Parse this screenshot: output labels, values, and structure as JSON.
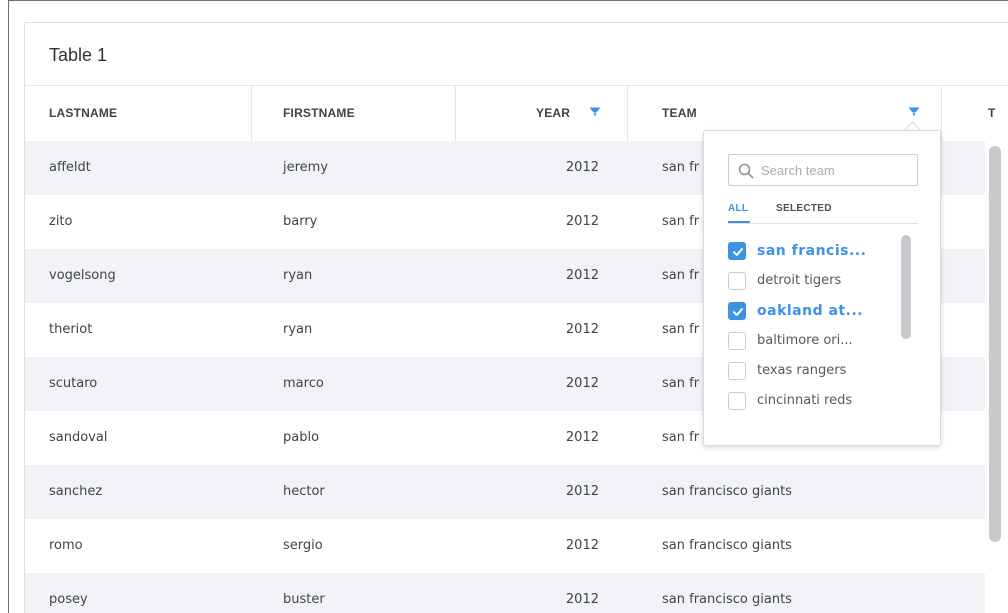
{
  "table": {
    "title": "Table 1",
    "columns": [
      {
        "key": "lastname",
        "label": "LASTNAME"
      },
      {
        "key": "firstname",
        "label": "FIRSTNAME"
      },
      {
        "key": "year",
        "label": "YEAR"
      },
      {
        "key": "team",
        "label": "TEAM"
      },
      {
        "key": "next",
        "label": "T"
      }
    ],
    "rows": [
      {
        "lastname": "affeldt",
        "firstname": "jeremy",
        "year": "2012",
        "team": "san fr"
      },
      {
        "lastname": "zito",
        "firstname": "barry",
        "year": "2012",
        "team": "san fr"
      },
      {
        "lastname": "vogelsong",
        "firstname": "ryan",
        "year": "2012",
        "team": "san fr"
      },
      {
        "lastname": "theriot",
        "firstname": "ryan",
        "year": "2012",
        "team": "san fr"
      },
      {
        "lastname": "scutaro",
        "firstname": "marco",
        "year": "2012",
        "team": "san fr"
      },
      {
        "lastname": "sandoval",
        "firstname": "pablo",
        "year": "2012",
        "team": "san fr"
      },
      {
        "lastname": "sanchez",
        "firstname": "hector",
        "year": "2012",
        "team": "san francisco giants"
      },
      {
        "lastname": "romo",
        "firstname": "sergio",
        "year": "2012",
        "team": "san francisco giants"
      },
      {
        "lastname": "posey",
        "firstname": "buster",
        "year": "2012",
        "team": "san francisco giants"
      }
    ]
  },
  "filter_dropdown": {
    "search_placeholder": "Search team",
    "tabs": {
      "all": "ALL",
      "selected": "SELECTED"
    },
    "active_tab": "ALL",
    "options": [
      {
        "label": "san francis...",
        "checked": true
      },
      {
        "label": "detroit tigers",
        "checked": false
      },
      {
        "label": "oakland at...",
        "checked": true
      },
      {
        "label": "baltimore ori...",
        "checked": false
      },
      {
        "label": "texas rangers",
        "checked": false
      },
      {
        "label": "cincinnati reds",
        "checked": false
      }
    ]
  },
  "colors": {
    "accent": "#3c93e6",
    "row_stripe": "#f2f3f6",
    "text": "#3f444a"
  },
  "icons": {
    "year_filter": "funnel-icon",
    "team_filter": "funnel-icon",
    "search": "magnifier-icon",
    "checkbox_checked": "checkmark-icon"
  }
}
